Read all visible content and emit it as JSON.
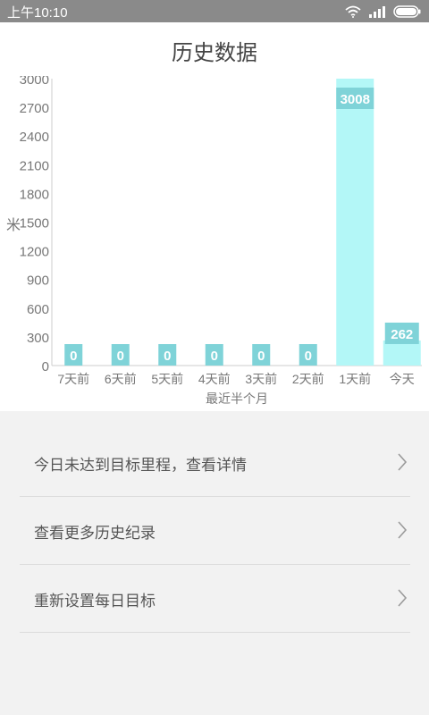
{
  "status_bar": {
    "time": "上午10:10",
    "wifi_icon": "wifi-icon",
    "signal_icon": "signal-icon",
    "battery_icon": "battery-icon"
  },
  "header": {
    "title": "历史数据"
  },
  "chart_data": {
    "type": "bar",
    "ylabel": "米",
    "xlabel": "最近半个月",
    "ylim": [
      0,
      3000
    ],
    "yticks": [
      0,
      300,
      600,
      900,
      1200,
      1500,
      1800,
      2100,
      2400,
      2700,
      3000
    ],
    "categories": [
      "7天前",
      "6天前",
      "5天前",
      "4天前",
      "3天前",
      "2天前",
      "1天前",
      "今天"
    ],
    "values": [
      0,
      0,
      0,
      0,
      0,
      0,
      3008,
      262
    ],
    "bar_color": "#b3f7f7",
    "label_bg": "#7fd3d8"
  },
  "menu": {
    "items": [
      {
        "label": "今日未达到目标里程，查看详情",
        "icon": "chevron-right-icon"
      },
      {
        "label": "查看更多历史纪录",
        "icon": "chevron-right-icon"
      },
      {
        "label": "重新设置每日目标",
        "icon": "chevron-right-icon"
      }
    ]
  }
}
